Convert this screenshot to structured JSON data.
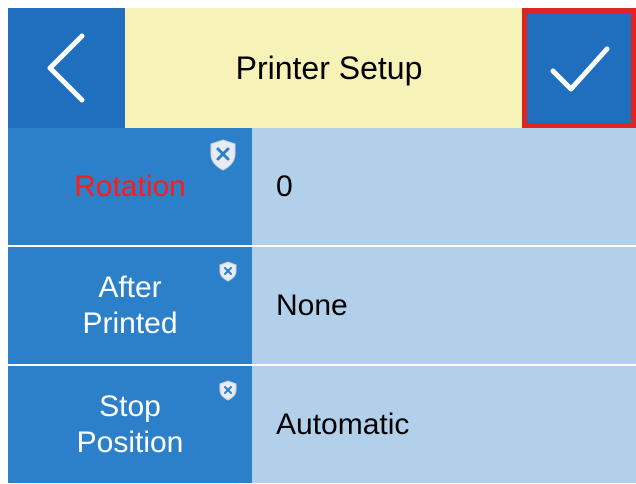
{
  "header": {
    "title": "Printer Setup",
    "back_icon": "chevron-left-icon",
    "confirm_icon": "checkmark-icon"
  },
  "rows": [
    {
      "label_line1": "Rotation",
      "label_line2": "",
      "value": "0",
      "highlighted": true,
      "badge_icon": "shield-x-icon"
    },
    {
      "label_line1": "After",
      "label_line2": "Printed",
      "value": "None",
      "highlighted": false,
      "badge_icon": "shield-x-icon"
    },
    {
      "label_line1": "Stop",
      "label_line2": "Position",
      "value": "Automatic",
      "highlighted": false,
      "badge_icon": "shield-x-icon"
    }
  ],
  "colors": {
    "header_button_bg": "#1f6fbe",
    "title_bg": "#f6f2b8",
    "label_bg": "#2c80c9",
    "value_bg": "#b3d0ea",
    "highlight_text": "#ff1a1a",
    "focus_border": "#e02424"
  }
}
